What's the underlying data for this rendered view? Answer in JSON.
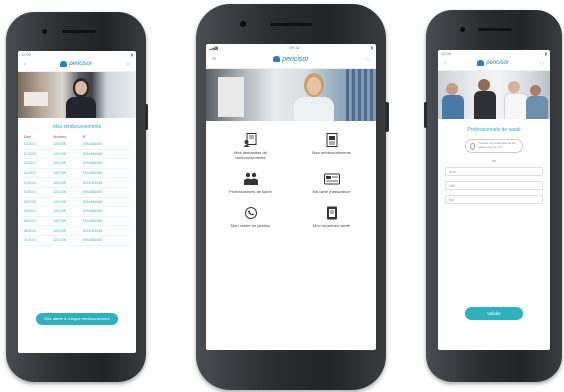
{
  "brand": {
    "name": "pericisor",
    "accent": "#2fb0bd",
    "link_blue": "#2a7fb8"
  },
  "phone1": {
    "status_time": "12:00",
    "title": "Mes remboursements",
    "columns": [
      "Date",
      "Montant",
      "N°"
    ],
    "rows": [
      [
        "12/2021",
        "120,00€",
        "0251984536"
      ],
      [
        "12/2021",
        "120,00€",
        "0251984536"
      ],
      [
        "11/2021",
        "120,00€",
        "0251984536"
      ],
      [
        "11/2021",
        "120,00€",
        "0251984536"
      ],
      [
        "10/2021",
        "120,00€",
        "0251984536"
      ],
      [
        "10/2021",
        "120,00€",
        "0251984536"
      ],
      [
        "09/2021",
        "120,00€",
        "0251984536"
      ],
      [
        "09/2021",
        "120,00€",
        "0251984536"
      ],
      [
        "08/2021",
        "120,00€",
        "0251984536"
      ],
      [
        "08/2021",
        "120,00€",
        "0251984536"
      ],
      [
        "07/2021",
        "120,00€",
        "0251984536"
      ]
    ],
    "button_label": "Être alerté à chaque remboursement"
  },
  "phone2": {
    "status_time": "09:14",
    "tiles": [
      {
        "label": "Mes demandes de remboursements",
        "icon": "document-person-icon"
      },
      {
        "label": "Mes remboursements",
        "icon": "document-icon"
      },
      {
        "label": "Professionnels de santé",
        "icon": "doctors-icon"
      },
      {
        "label": "Ma carte d'assurance",
        "icon": "card-icon"
      },
      {
        "label": "Mon centre de gestion",
        "icon": "phone-handset-icon"
      },
      {
        "label": "Mon répertoire santé",
        "icon": "directory-icon"
      }
    ]
  },
  "phone3": {
    "status_time": "12:00",
    "title": "Professionnels de santé",
    "chip_text": "Trouver un professionnel de santé près de moi",
    "or_text": "ou",
    "fields": [
      "Nom",
      "Ville",
      "Nat"
    ],
    "button_label": "Valider"
  }
}
